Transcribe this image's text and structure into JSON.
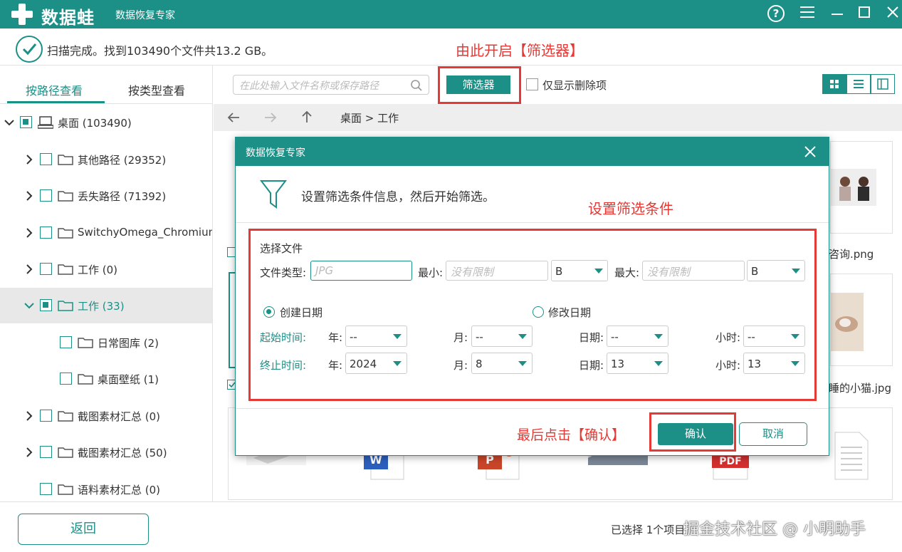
{
  "titlebar": {
    "brand": "数据蛙",
    "title": "数据恢复专家"
  },
  "status": {
    "text": "扫描完成。找到103490个文件共13.2 GB。"
  },
  "notes": {
    "open_filter": "由此开启【筛选器】",
    "set_conditions": "设置筛选条件",
    "click_confirm": "最后点击【确认】"
  },
  "tabs": {
    "by_path": "按路径查看",
    "by_type": "按类型查看"
  },
  "tree": [
    {
      "label": "桌面 (103490)",
      "expanded": true,
      "checked": "partial"
    },
    {
      "label": "其他路径 (29352)",
      "expanded": false,
      "checked": "none"
    },
    {
      "label": "丢失路径 (71392)",
      "expanded": false,
      "checked": "none"
    },
    {
      "label": "SwitchyOmega_Chromium",
      "expanded": false,
      "checked": "none"
    },
    {
      "label": "工作 (0)",
      "expanded": false,
      "checked": "none"
    },
    {
      "label": "工作 (33)",
      "expanded": true,
      "checked": "partial",
      "selected": true
    },
    {
      "label": "日常图库 (2)",
      "checked": "none"
    },
    {
      "label": "桌面壁纸 (1)",
      "checked": "none"
    },
    {
      "label": "截图素材汇总 (0)",
      "expanded": false,
      "checked": "none"
    },
    {
      "label": "截图素材汇总 (50)",
      "expanded": false,
      "checked": "none"
    },
    {
      "label": "语料素材汇总 (0)",
      "checked": "none"
    }
  ],
  "toolbar": {
    "search_placeholder": "在此处输入文件名称或保存路径",
    "filter_button": "筛选器",
    "only_deleted": "仅显示删除项"
  },
  "nav": {
    "breadcrumb": "桌面 > 工作"
  },
  "files": {
    "file1": "咨询.png",
    "file2": "睡的小猫.jpg"
  },
  "dialog": {
    "title": "数据恢复专家",
    "instruction": "设置筛选条件信息，然后开始筛选。",
    "section": "选择文件",
    "file_type_label": "文件类型:",
    "file_type_placeholder": "JPG",
    "min_label": "最小:",
    "min_placeholder": "没有限制",
    "min_unit": "B",
    "max_label": "最大:",
    "max_placeholder": "没有限制",
    "max_unit": "B",
    "create_date": "创建日期",
    "modify_date": "修改日期",
    "start_label": "起始时间:",
    "end_label": "终止时间:",
    "year_label": "年:",
    "month_label": "月:",
    "day_label": "日期:",
    "hour_label": "小时:",
    "start": {
      "year": "--",
      "month": "--",
      "day": "--",
      "hour": "--"
    },
    "end": {
      "year": "2024",
      "month": "8",
      "day": "13",
      "hour": "13"
    },
    "confirm": "确认",
    "cancel": "取消"
  },
  "bottom": {
    "back": "返回",
    "selected": "已选择 1个项目",
    "watermark": "掘金技术社区 @ 小明助手"
  },
  "colors": {
    "accent": "#1c8f86",
    "annotation": "#e53935"
  }
}
